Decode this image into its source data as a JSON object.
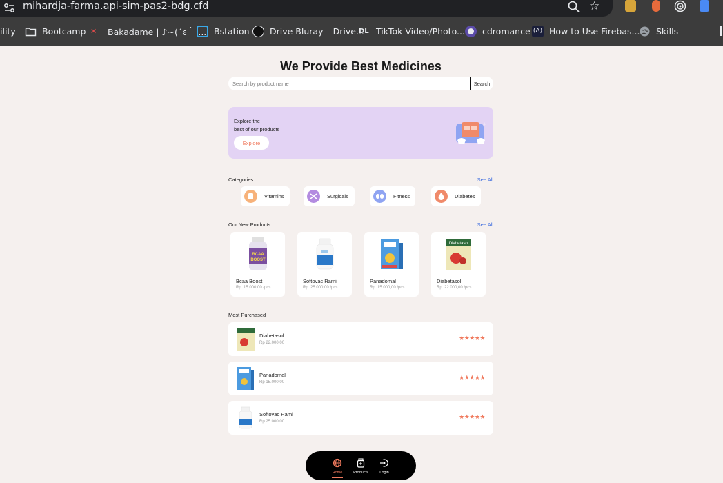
{
  "browser": {
    "url": "mihardja-farma.api-sim-pas2-bdg.cfd",
    "bookmarks": [
      {
        "label": "ility",
        "icon": "none"
      },
      {
        "label": "Bootcamp",
        "icon": "folder-icon"
      },
      {
        "label": "Bakadame | ♪~(´ε｀ ...",
        "icon": "bakadame-icon"
      },
      {
        "label": "Bstation",
        "icon": "bstation-icon"
      },
      {
        "label": "Drive Bluray – Drive...",
        "icon": "drive-bluray-icon"
      },
      {
        "label": "TikTok Video/Photo...",
        "icon": "tiktok-dl-icon"
      },
      {
        "label": "cdromance",
        "icon": "cdromance-icon"
      },
      {
        "label": "How to Use Firebas...",
        "icon": "firebase-icon"
      },
      {
        "label": "Skills",
        "icon": "globe-icon"
      }
    ]
  },
  "page": {
    "title": "We Provide Best Medicines",
    "search": {
      "placeholder": "Search by product name",
      "button": "Search"
    },
    "banner": {
      "line1": "Explore the",
      "line2": "best of our products",
      "button": "Explore"
    },
    "categories": {
      "label": "Categories",
      "see_all": "See All",
      "items": [
        {
          "label": "Vitamins",
          "color": "#f7b27a"
        },
        {
          "label": "Surgicals",
          "color": "#b38be0"
        },
        {
          "label": "Fitness",
          "color": "#8fa4f2"
        },
        {
          "label": "Diabetes",
          "color": "#f08a6a"
        }
      ]
    },
    "new_products": {
      "label": "Our New Products",
      "see_all": "See All",
      "items": [
        {
          "name": "Bcaa Boost",
          "price": "Rp. 15.000,00 /pcs"
        },
        {
          "name": "Softovac Rami",
          "price": "Rp. 25.000,00 /pcs"
        },
        {
          "name": "Panadomal",
          "price": "Rp. 15.000,00 /pcs"
        },
        {
          "name": "Diabetasol",
          "price": "Rp. 22.000,00 /pcs"
        }
      ]
    },
    "most_purchased": {
      "label": "Most Purchased",
      "items": [
        {
          "name": "Diabetasol",
          "price": "Rp 22.000,00",
          "rating": "★★★★★"
        },
        {
          "name": "Panadomal",
          "price": "Rp 15.000,00",
          "rating": "★★★★★"
        },
        {
          "name": "Softovac Rami",
          "price": "Rp 25.000,00",
          "rating": "★★★★★"
        }
      ]
    },
    "nav": {
      "home": "Home",
      "products": "Products",
      "login": "Login",
      "accent": "#f07a5e"
    }
  }
}
